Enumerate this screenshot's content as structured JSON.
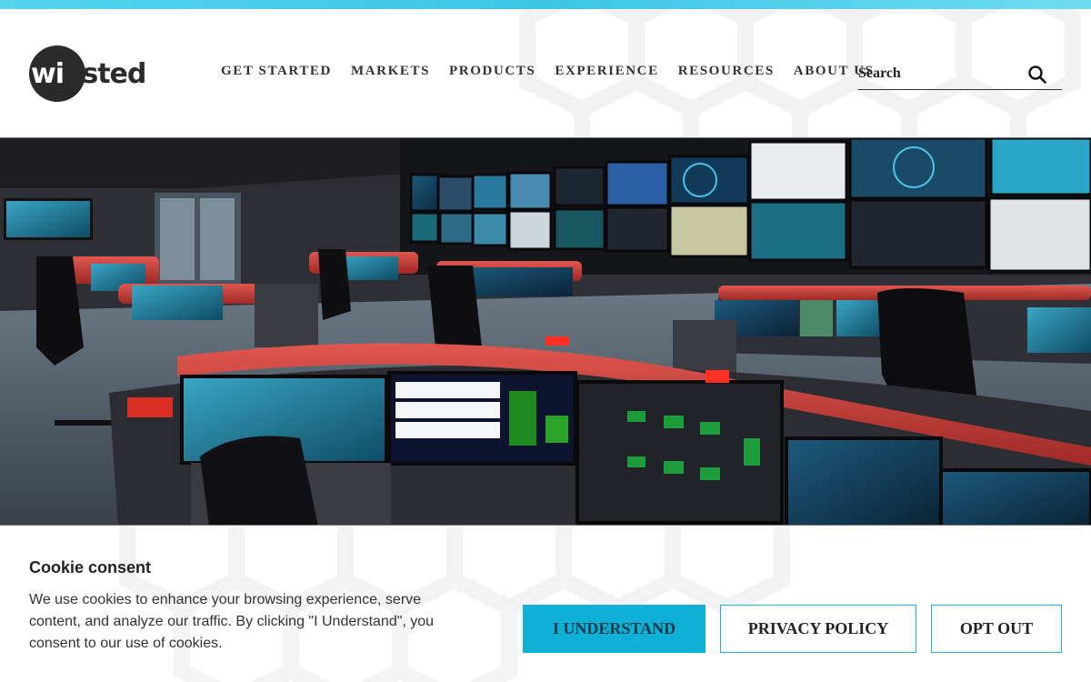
{
  "brand": {
    "logo_w": "wi",
    "logo_rest": "nsted"
  },
  "nav": {
    "items": [
      "GET STARTED",
      "MARKETS",
      "PRODUCTS",
      "EXPERIENCE",
      "RESOURCES",
      "ABOUT US"
    ]
  },
  "search": {
    "placeholder": "Search"
  },
  "hero": {
    "alt": "Control room with curved consoles and video wall"
  },
  "cookie": {
    "title": "Cookie consent",
    "text": "We use cookies to enhance your browsing experience, serve content, and analyze our traffic. By clicking \"I Understand\", you consent to our use of cookies.",
    "understand_label": "I UNDERSTAND",
    "privacy_label": "PRIVACY POLICY",
    "optout_label": "OPT OUT"
  },
  "colors": {
    "accent": "#0fb0d6",
    "top_strip": "#3cc6e6",
    "dark": "#2b2b2b"
  }
}
